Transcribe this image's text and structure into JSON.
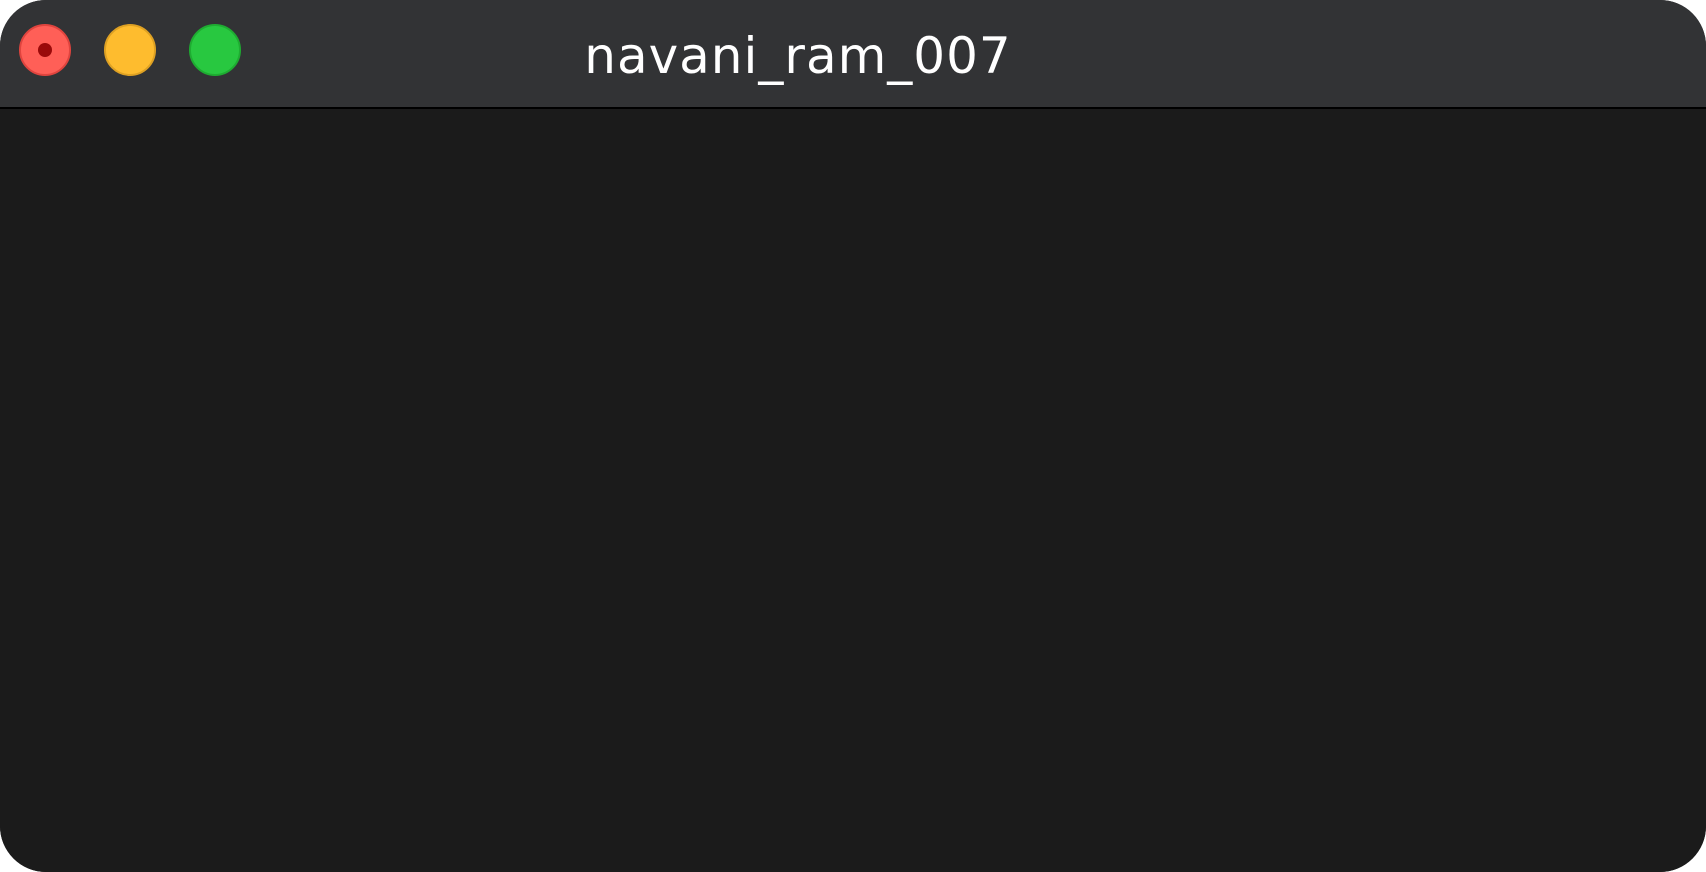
{
  "window": {
    "title": "navani_ram_007",
    "background_color": "#1b1b1b",
    "titlebar_color": "#323335",
    "controls": {
      "close": {
        "icon": "close-icon",
        "color": "#ff5f57"
      },
      "minimize": {
        "icon": "minimize-icon",
        "color": "#febc2e"
      },
      "zoom": {
        "icon": "zoom-icon",
        "color": "#28c840"
      }
    }
  }
}
